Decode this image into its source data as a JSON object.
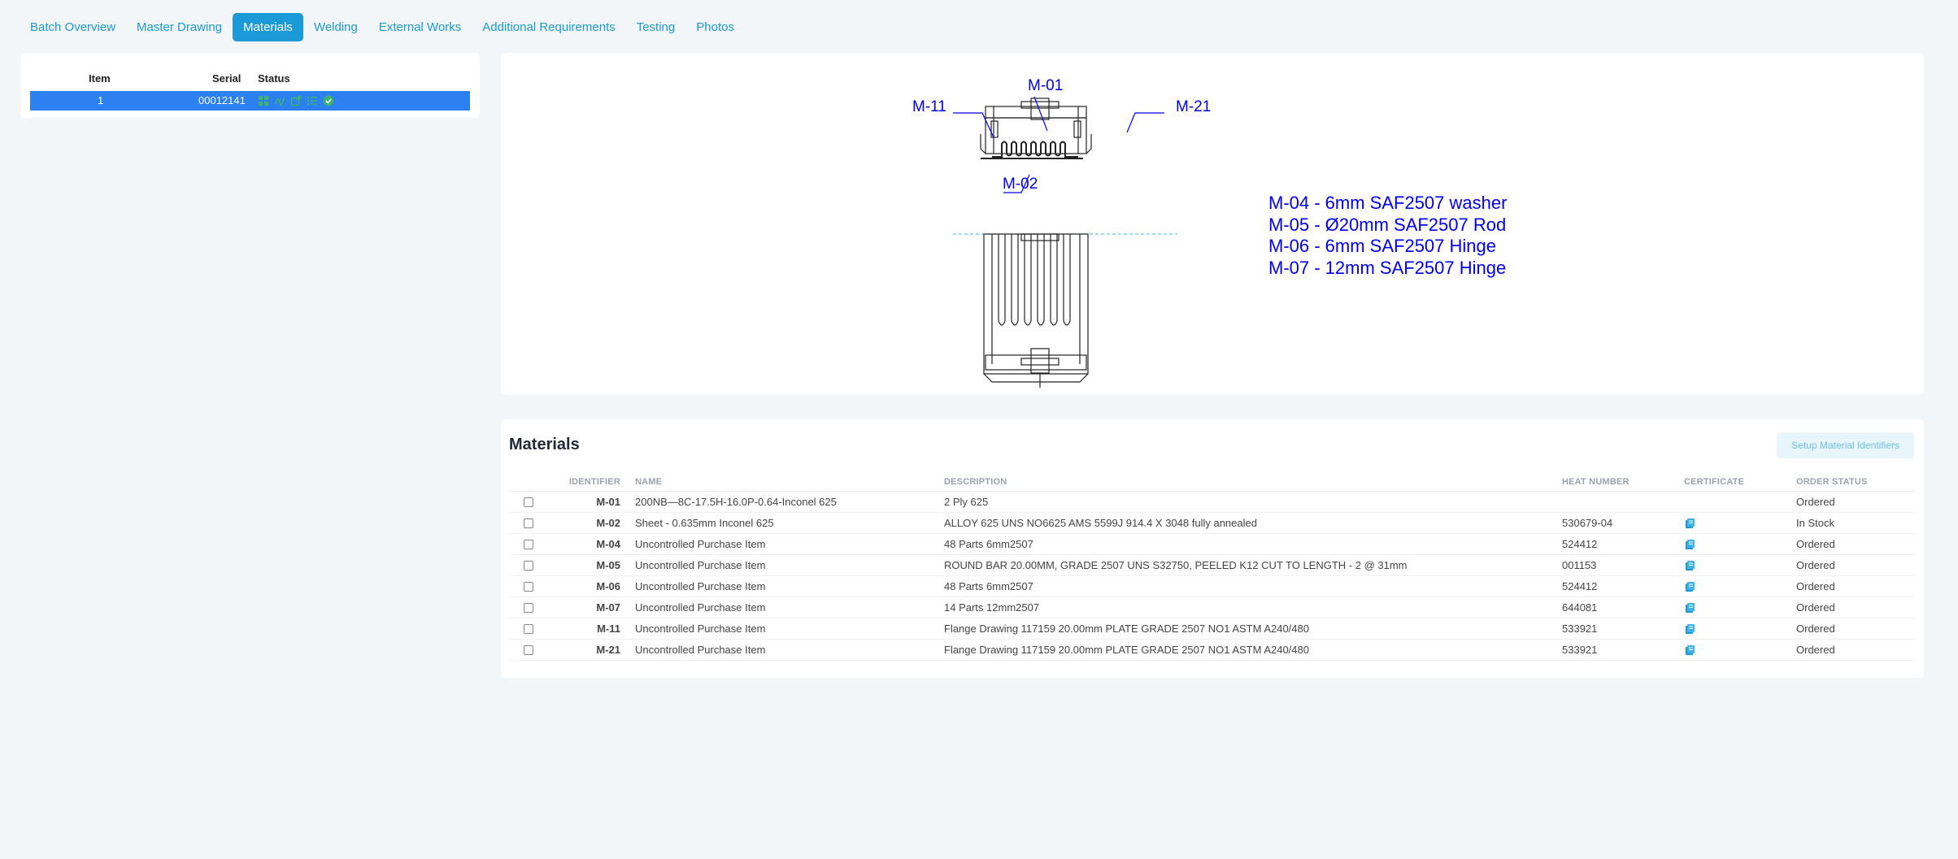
{
  "tabs": [
    {
      "label": "Batch Overview",
      "active": false
    },
    {
      "label": "Master Drawing",
      "active": false
    },
    {
      "label": "Materials",
      "active": true
    },
    {
      "label": "Welding",
      "active": false
    },
    {
      "label": "External Works",
      "active": false
    },
    {
      "label": "Additional Requirements",
      "active": false
    },
    {
      "label": "Testing",
      "active": false
    },
    {
      "label": "Photos",
      "active": false
    }
  ],
  "batch_table": {
    "headers": {
      "item": "Item",
      "serial": "Serial",
      "status": "Status"
    },
    "rows": [
      {
        "item": "1",
        "serial": "00012141",
        "status_icons": [
          "grid-icon",
          "signature-icon",
          "external-link-icon",
          "list-icon",
          "check-circle-icon"
        ]
      }
    ]
  },
  "drawing": {
    "labels": {
      "m01": "M-01",
      "m11": "M-11",
      "m21": "M-21",
      "m02": "M-02"
    },
    "notes": [
      "M-04 - 6mm SAF2507 washer",
      "M-05 - Ø20mm SAF2507 Rod",
      "M-06 - 6mm SAF2507 Hinge",
      "M-07 - 12mm SAF2507 Hinge"
    ],
    "note_color": "#0000ff"
  },
  "materials": {
    "title": "Materials",
    "setup_button": "Setup Material Identifiers",
    "columns": [
      "IDENTIFIER",
      "NAME",
      "DESCRIPTION",
      "HEAT NUMBER",
      "CERTIFICATE",
      "ORDER STATUS"
    ],
    "rows": [
      {
        "id": "M-01",
        "name": "200NB—8C-17.5H-16.0P-0.64-Inconel 625",
        "description": "2 Ply 625",
        "heat": "",
        "cert": false,
        "status": "Ordered"
      },
      {
        "id": "M-02",
        "name": "Sheet - 0.635mm Inconel 625",
        "description": "ALLOY 625 UNS NO6625 AMS 5599J 914.4 X 3048 fully annealed",
        "heat": "530679-04",
        "cert": true,
        "status": "In Stock"
      },
      {
        "id": "M-04",
        "name": "Uncontrolled Purchase Item",
        "description": "48 Parts 6mm2507",
        "heat": "524412",
        "cert": true,
        "status": "Ordered"
      },
      {
        "id": "M-05",
        "name": "Uncontrolled Purchase Item",
        "description": "ROUND BAR 20.00MM, GRADE 2507 UNS S32750, PEELED K12 CUT TO LENGTH - 2 @ 31mm",
        "heat": "001153",
        "cert": true,
        "status": "Ordered"
      },
      {
        "id": "M-06",
        "name": "Uncontrolled Purchase Item",
        "description": "48 Parts 6mm2507",
        "heat": "524412",
        "cert": true,
        "status": "Ordered"
      },
      {
        "id": "M-07",
        "name": "Uncontrolled Purchase Item",
        "description": "14 Parts 12mm2507",
        "heat": "644081",
        "cert": true,
        "status": "Ordered"
      },
      {
        "id": "M-11",
        "name": "Uncontrolled Purchase Item",
        "description": "Flange Drawing 117159 20.00mm PLATE GRADE 2507 NO1 ASTM A240/480",
        "heat": "533921",
        "cert": true,
        "status": "Ordered"
      },
      {
        "id": "M-21",
        "name": "Uncontrolled Purchase Item",
        "description": "Flange Drawing 117159 20.00mm PLATE GRADE 2507 NO1 ASTM A240/480",
        "heat": "533921",
        "cert": true,
        "status": "Ordered"
      }
    ]
  },
  "colors": {
    "accent": "#1a9ad6",
    "selected_row": "#2c80f0",
    "status_green": "#3cb371"
  }
}
